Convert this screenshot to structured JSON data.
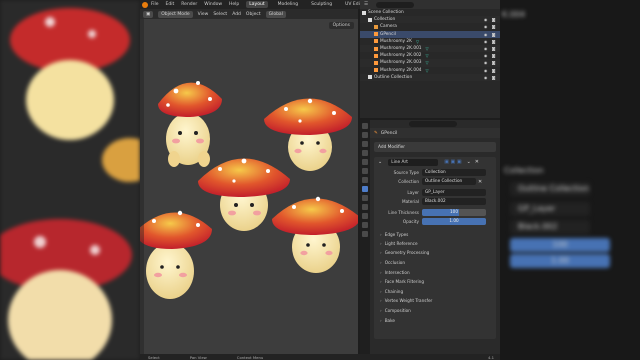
{
  "window": {
    "menus": [
      "File",
      "Edit",
      "Render",
      "Window",
      "Help"
    ],
    "workspaces": [
      "Layout",
      "Modeling",
      "Sculpting",
      "UV Editing"
    ],
    "active_workspace": "Layout",
    "scene_label": "Scene",
    "view_layer_label": "ViewLayer"
  },
  "viewport": {
    "mode": "Object Mode",
    "menus": [
      "View",
      "Select",
      "Add",
      "Object"
    ],
    "transform_orientation": "Global",
    "options_label": "Options"
  },
  "outliner": {
    "rows": [
      {
        "label": "Scene Collection",
        "icon": "collection-icon",
        "color": "#dddddd"
      },
      {
        "label": "Collection",
        "icon": "collection-icon",
        "color": "#dddddd"
      },
      {
        "label": "Camera",
        "icon": "camera-icon",
        "color": "#e89a3c"
      },
      {
        "label": "GPencil",
        "icon": "gpencil-icon",
        "color": "#ff9a3c"
      },
      {
        "label": "Mushroomy 2K",
        "icon": "mesh-icon",
        "color": "#ff9a3c"
      },
      {
        "label": "Mushroomy 2K.001",
        "icon": "mesh-icon",
        "color": "#ff9a3c"
      },
      {
        "label": "Mushroomy 2K.002",
        "icon": "mesh-icon",
        "color": "#ff9a3c"
      },
      {
        "label": "Mushroomy 2K.003",
        "icon": "mesh-icon",
        "color": "#ff9a3c"
      },
      {
        "label": "Mushroomy 2K.004",
        "icon": "mesh-icon",
        "color": "#ff9a3c"
      },
      {
        "label": "Outline Collection",
        "icon": "collection-icon",
        "color": "#dddddd"
      }
    ]
  },
  "properties": {
    "object_name": "GPencil",
    "add_modifier_label": "Add Modifier",
    "modifier_name": "Line Art",
    "fields": [
      {
        "label": "Source Type",
        "value": "Collection"
      },
      {
        "label": "Collection",
        "value": "Outline Collection"
      },
      {
        "label": "Layer",
        "value": "GP_Layer"
      },
      {
        "label": "Material",
        "value": "Black.002"
      }
    ],
    "line_thickness": {
      "label": "Line Thickness",
      "value": "100",
      "fill": 0.58
    },
    "opacity": {
      "label": "Opacity",
      "value": "1.00",
      "fill": 1.0
    },
    "sections": [
      "Edge Types",
      "Light Reference",
      "Geometry Processing",
      "Occlusion",
      "Intersection",
      "Face Mark Filtering",
      "Chaining",
      "Vertex Weight Transfer",
      "Composition",
      "Bake"
    ]
  },
  "statusbar": {
    "items": [
      "Select",
      "Pan View",
      "Context Menu"
    ],
    "version": "4.1"
  },
  "blurred_right": {
    "collection_tab": "Collection",
    "collection_value": "Outline Collection",
    "layer_value": "GP_Layer",
    "material_value": "Black.002",
    "thickness_value": "100",
    "opacity_value": "1.00",
    "row_k": "K.004"
  },
  "colors": {
    "accent_blue": "#4772b3",
    "mesh_green": "#3fd3b5",
    "object_orange": "#ff9a3c"
  }
}
